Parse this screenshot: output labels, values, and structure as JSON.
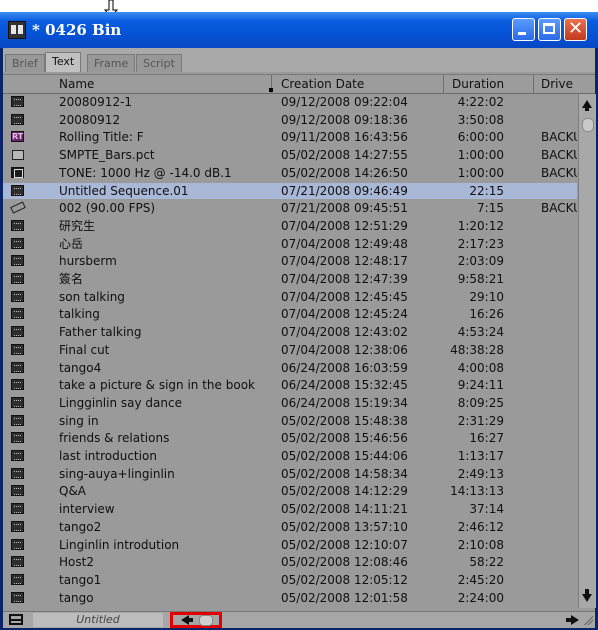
{
  "window": {
    "title": "* 0426 Bin",
    "controls": [
      "minimize",
      "maximize",
      "close"
    ]
  },
  "tabs": [
    {
      "label": "Brief",
      "active": false
    },
    {
      "label": "Text",
      "active": true
    },
    {
      "label": "Frame",
      "active": false
    },
    {
      "label": "Script",
      "active": false
    }
  ],
  "columns": {
    "name": "Name",
    "creation_date": "Creation Date",
    "duration": "Duration",
    "drive": "Drive"
  },
  "rows": [
    {
      "icon": "sequence-icon",
      "name": "20080912-1",
      "date": "09/12/2008 09:22:04",
      "duration": "4:22:02",
      "drive": ""
    },
    {
      "icon": "sequence-icon",
      "name": "20080912",
      "date": "09/12/2008 09:18:36",
      "duration": "3:50:08",
      "drive": ""
    },
    {
      "icon": "title-icon",
      "name": "Rolling Title: F",
      "date": "09/11/2008 16:43:56",
      "duration": "6:00:00",
      "drive": "BACKU"
    },
    {
      "icon": "image-icon",
      "name": "SMPTE_Bars.pct",
      "date": "05/02/2008 14:27:55",
      "duration": "1:00:00",
      "drive": "BACKU"
    },
    {
      "icon": "tone-icon",
      "name": "TONE: 1000 Hz @ -14.0 dB.1",
      "date": "05/02/2008 14:26:50",
      "duration": "1:00:00",
      "drive": "BACKU"
    },
    {
      "icon": "sequence-icon",
      "name": "Untitled Sequence.01",
      "date": "07/21/2008 09:46:49",
      "duration": "22:15",
      "drive": "",
      "selected": true
    },
    {
      "icon": "effect-icon",
      "name": "002 (90.00 FPS)",
      "date": "07/21/2008 09:45:51",
      "duration": "7:15",
      "drive": "BACKU"
    },
    {
      "icon": "sequence-icon",
      "name": "研究生",
      "date": "07/04/2008 12:51:29",
      "duration": "1:20:12",
      "drive": ""
    },
    {
      "icon": "sequence-icon",
      "name": "心岳",
      "date": "07/04/2008 12:49:48",
      "duration": "2:17:23",
      "drive": ""
    },
    {
      "icon": "sequence-icon",
      "name": "hursberm",
      "date": "07/04/2008 12:48:17",
      "duration": "2:03:09",
      "drive": ""
    },
    {
      "icon": "sequence-icon",
      "name": "簽名",
      "date": "07/04/2008 12:47:39",
      "duration": "9:58:21",
      "drive": ""
    },
    {
      "icon": "sequence-icon",
      "name": "son talking",
      "date": "07/04/2008 12:45:45",
      "duration": "29:10",
      "drive": ""
    },
    {
      "icon": "sequence-icon",
      "name": "talking",
      "date": "07/04/2008 12:45:24",
      "duration": "16:26",
      "drive": ""
    },
    {
      "icon": "sequence-icon",
      "name": "Father talking",
      "date": "07/04/2008 12:43:02",
      "duration": "4:53:24",
      "drive": ""
    },
    {
      "icon": "sequence-icon",
      "name": "Final cut",
      "date": "07/04/2008 12:38:06",
      "duration": "48:38:28",
      "drive": ""
    },
    {
      "icon": "sequence-icon",
      "name": "tango4",
      "date": "06/24/2008 16:03:59",
      "duration": "4:00:08",
      "drive": ""
    },
    {
      "icon": "sequence-icon",
      "name": "take a picture & sign in the book",
      "date": "06/24/2008 15:32:45",
      "duration": "9:24:11",
      "drive": ""
    },
    {
      "icon": "sequence-icon",
      "name": "Lingginlin say dance",
      "date": "06/24/2008 15:19:34",
      "duration": "8:09:25",
      "drive": ""
    },
    {
      "icon": "sequence-icon",
      "name": "sing in",
      "date": "05/02/2008 15:48:38",
      "duration": "2:31:29",
      "drive": ""
    },
    {
      "icon": "sequence-icon",
      "name": "friends & relations",
      "date": "05/02/2008 15:46:56",
      "duration": "16:27",
      "drive": ""
    },
    {
      "icon": "sequence-icon",
      "name": "last introduction",
      "date": "05/02/2008 15:44:06",
      "duration": "1:13:17",
      "drive": ""
    },
    {
      "icon": "sequence-icon",
      "name": "sing-auya+linginlin",
      "date": "05/02/2008 14:58:34",
      "duration": "2:49:13",
      "drive": ""
    },
    {
      "icon": "sequence-icon",
      "name": "Q&A",
      "date": "05/02/2008 14:12:29",
      "duration": "14:13:13",
      "drive": ""
    },
    {
      "icon": "sequence-icon",
      "name": "interview",
      "date": "05/02/2008 14:11:21",
      "duration": "37:14",
      "drive": ""
    },
    {
      "icon": "sequence-icon",
      "name": "tango2",
      "date": "05/02/2008 13:57:10",
      "duration": "2:46:12",
      "drive": ""
    },
    {
      "icon": "sequence-icon",
      "name": "Linginlin introdution",
      "date": "05/02/2008 12:10:07",
      "duration": "2:10:08",
      "drive": ""
    },
    {
      "icon": "sequence-icon",
      "name": "Host2",
      "date": "05/02/2008 12:08:46",
      "duration": "58:22",
      "drive": ""
    },
    {
      "icon": "sequence-icon",
      "name": "tango1",
      "date": "05/02/2008 12:05:12",
      "duration": "2:45:20",
      "drive": ""
    },
    {
      "icon": "sequence-icon",
      "name": "tango",
      "date": "05/02/2008 12:01:58",
      "duration": "2:24:00",
      "drive": ""
    }
  ],
  "statusbar": {
    "view_label": "Untitled"
  },
  "colors": {
    "titlebar": "#0553d6",
    "content_bg": "#9a9a9a",
    "selected_row": "#a8b8d6",
    "highlight_box": "#e00000"
  }
}
